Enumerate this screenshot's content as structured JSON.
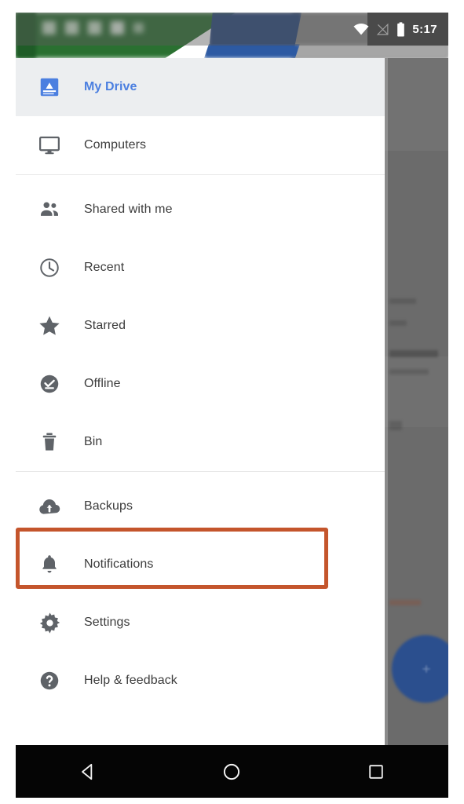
{
  "status_bar": {
    "time": "5:17",
    "icons": [
      "wifi-icon",
      "no-signal-icon",
      "battery-icon"
    ]
  },
  "drawer": {
    "groups": [
      {
        "items": [
          {
            "label": "My Drive",
            "icon": "drive-icon",
            "selected": true
          },
          {
            "label": "Computers",
            "icon": "monitor-icon",
            "selected": false
          }
        ]
      },
      {
        "items": [
          {
            "label": "Shared with me",
            "icon": "people-icon",
            "selected": false
          },
          {
            "label": "Recent",
            "icon": "clock-icon",
            "selected": false
          },
          {
            "label": "Starred",
            "icon": "star-icon",
            "selected": false
          },
          {
            "label": "Offline",
            "icon": "check-circle-icon",
            "selected": false
          },
          {
            "label": "Bin",
            "icon": "trash-icon",
            "selected": false
          }
        ]
      },
      {
        "items": [
          {
            "label": "Backups",
            "icon": "cloud-upload-icon",
            "selected": false,
            "highlighted": true
          },
          {
            "label": "Notifications",
            "icon": "bell-icon",
            "selected": false
          },
          {
            "label": "Settings",
            "icon": "gear-icon",
            "selected": false
          },
          {
            "label": "Help & feedback",
            "icon": "help-circle-icon",
            "selected": false
          }
        ]
      }
    ]
  },
  "navigation_bar": {
    "buttons": [
      {
        "name": "back-button",
        "icon": "triangle-left-icon"
      },
      {
        "name": "home-button",
        "icon": "circle-icon"
      },
      {
        "name": "recents-button",
        "icon": "square-icon"
      }
    ]
  },
  "colors": {
    "accent_blue": "#4b7fe0",
    "highlight_orange": "#c4552c",
    "selected_row": "#eceef0",
    "icon_gray": "#5f6368",
    "scrim": "#6b6b6b",
    "header_green": "#2a7031",
    "header_blue": "#27477f",
    "navbar_black": "#050505"
  }
}
